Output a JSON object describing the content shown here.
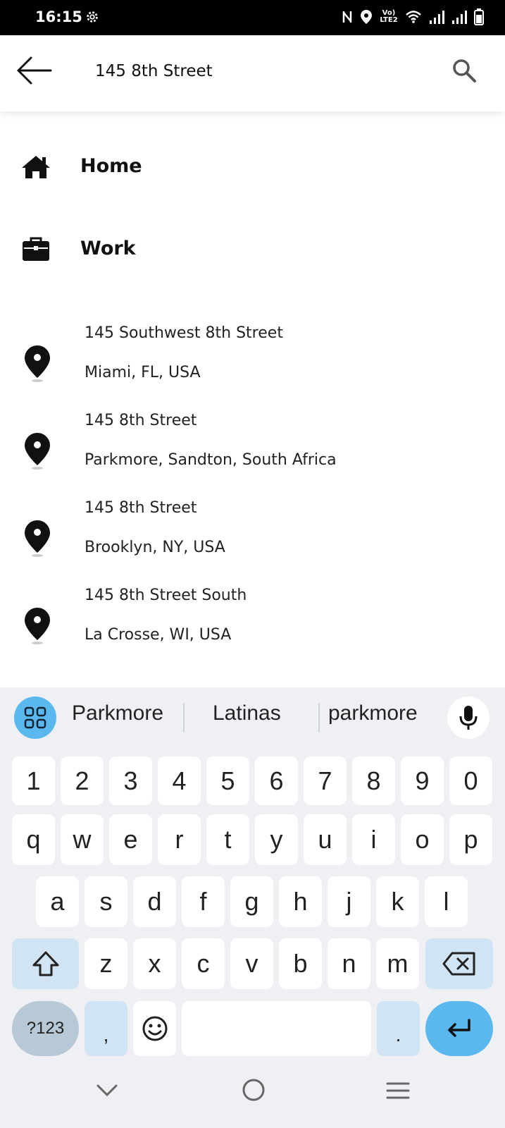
{
  "status_bar": {
    "time": "16:15",
    "lte_label": "Vo) LTE2"
  },
  "search": {
    "query": "145 8th Street"
  },
  "favorites": [
    {
      "label": "Home"
    },
    {
      "label": "Work"
    }
  ],
  "results": [
    {
      "line1": "145 Southwest 8th Street",
      "line2": "Miami, FL, USA"
    },
    {
      "line1": "145 8th Street",
      "line2": "Parkmore, Sandton, South Africa"
    },
    {
      "line1": "145 8th Street",
      "line2": "Brooklyn, NY, USA"
    },
    {
      "line1": "145 8th Street South",
      "line2": "La Crosse, WI, USA"
    }
  ],
  "keyboard": {
    "suggestions": [
      "Parkmore",
      "Latinas",
      "parkmore"
    ],
    "number_row": [
      "1",
      "2",
      "3",
      "4",
      "5",
      "6",
      "7",
      "8",
      "9",
      "0"
    ],
    "row1": [
      "q",
      "w",
      "e",
      "r",
      "t",
      "y",
      "u",
      "i",
      "o",
      "p"
    ],
    "row2": [
      "a",
      "s",
      "d",
      "f",
      "g",
      "h",
      "j",
      "k",
      "l"
    ],
    "row3": [
      "z",
      "x",
      "c",
      "v",
      "b",
      "n",
      "m"
    ],
    "symbols_label": "?123",
    "comma_label": ",",
    "period_label": "."
  },
  "colors": {
    "accent_blue": "#5ab8ee",
    "key_dark": "#d1e4f3",
    "keyboard_bg": "#eef0f3"
  }
}
